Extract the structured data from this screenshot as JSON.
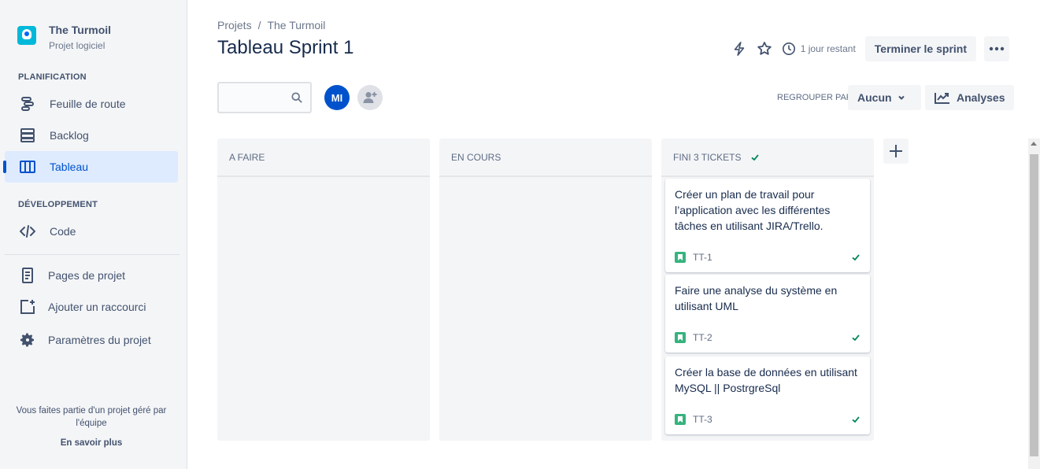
{
  "sidebar": {
    "project_name": "The Turmoil",
    "project_type": "Projet logiciel",
    "section_planning": "PLANIFICATION",
    "section_dev": "DÉVELOPPEMENT",
    "items": [
      {
        "label": "Feuille de route",
        "icon": "roadmap-icon"
      },
      {
        "label": "Backlog",
        "icon": "backlog-icon"
      },
      {
        "label": "Tableau",
        "icon": "board-icon",
        "active": true
      },
      {
        "label": "Code",
        "icon": "code-icon"
      },
      {
        "label": "Pages de projet",
        "icon": "page-icon"
      },
      {
        "label": "Ajouter un raccourci",
        "icon": "add-shortcut-icon"
      },
      {
        "label": "Paramètres du projet",
        "icon": "gear-icon"
      }
    ],
    "footer_note": "Vous faites partie d'un projet géré par l'équipe",
    "footer_link": "En savoir plus"
  },
  "breadcrumb": {
    "root": "Projets",
    "separator": "/",
    "project": "The Turmoil"
  },
  "page_title": "Tableau Sprint 1",
  "header": {
    "time_left": "1 jour restant",
    "complete_sprint": "Terminer le sprint"
  },
  "toolbar": {
    "search_placeholder": "",
    "avatar_initials": "MI",
    "group_by_label": "REGROUPER PAR",
    "group_by_value": "Aucun",
    "analyses_label": "Analyses"
  },
  "columns": [
    {
      "title": "A FAIRE",
      "cards": []
    },
    {
      "title": "EN COURS",
      "cards": []
    },
    {
      "title": "FINI 3 TICKETS",
      "cards": [
        {
          "summary": "Créer un plan de travail pour l’application avec les différentes tâches en utilisant JIRA/Trello.",
          "key": "TT-1",
          "type": "story"
        },
        {
          "summary": "Faire une analyse du système en utilisant UML",
          "key": "TT-2",
          "type": "story"
        },
        {
          "summary": "Créer la base de données en utilisant MySQL || PostrgreSql",
          "key": "TT-3",
          "type": "story"
        }
      ]
    }
  ],
  "colors": {
    "accent": "#0052cc",
    "sidebar_bg": "#f4f5f7",
    "active_bg": "#deebff",
    "done_green": "#36b37e"
  }
}
